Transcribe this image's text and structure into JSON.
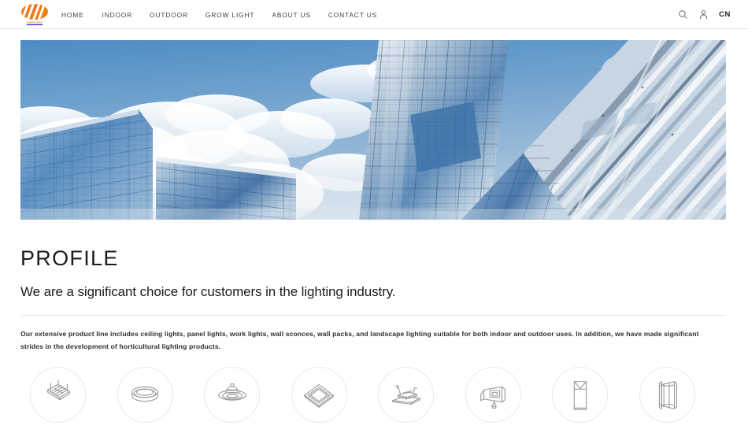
{
  "header": {
    "logo": {
      "name": "shenone-logo",
      "wordmark": "SHENONE",
      "color": "#ef7d1a"
    },
    "nav": [
      {
        "label": "HOME",
        "name": "nav-home"
      },
      {
        "label": "INDOOR",
        "name": "nav-indoor"
      },
      {
        "label": "OUTDOOR",
        "name": "nav-outdoor"
      },
      {
        "label": "GROW LIGHT",
        "name": "nav-grow-light"
      },
      {
        "label": "ABOUT US",
        "name": "nav-about-us"
      },
      {
        "label": "CONTACT US",
        "name": "nav-contact-us"
      }
    ],
    "actions": {
      "search_icon": "search-icon",
      "account_icon": "user-account-icon",
      "language": "CN"
    }
  },
  "hero": {
    "name": "hero-banner",
    "alt": "Low angle view of glass skyscrapers against a blue sky with clouds",
    "sky_color": "#5a93c4",
    "glass_color": "#4a7fb5"
  },
  "main": {
    "title": "PROFILE",
    "subtitle": "We are a significant choice for customers in the lighting industry.",
    "paragraph": "Our extensive product line includes ceiling lights, panel lights, work lights, wall sconces, wall packs, and landscape lighting suitable for both indoor and outdoor uses. In addition, we have made significant strides in the development of horticultural lighting products."
  },
  "products": [
    {
      "name": "grow-light-bar-icon",
      "label": "Grow Light Bar"
    },
    {
      "name": "round-ceiling-light-icon",
      "label": "Round Ceiling Light"
    },
    {
      "name": "ufo-high-bay-icon",
      "label": "UFO High Bay"
    },
    {
      "name": "panel-light-icon",
      "label": "Panel Light"
    },
    {
      "name": "work-light-icon",
      "label": "Work Light"
    },
    {
      "name": "flood-light-icon",
      "label": "Flood Light"
    },
    {
      "name": "bollard-light-icon",
      "label": "Bollard Light"
    },
    {
      "name": "wall-sconce-icon",
      "label": "Wall Sconce"
    }
  ]
}
